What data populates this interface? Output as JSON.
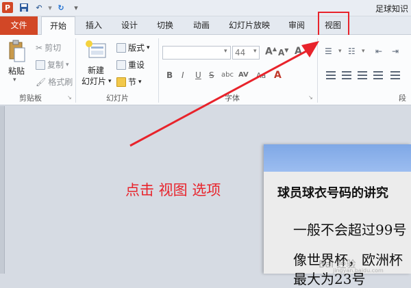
{
  "app": {
    "title": "足球知识",
    "logo_letter": "P"
  },
  "tabs": [
    "文件",
    "开始",
    "插入",
    "设计",
    "切换",
    "动画",
    "幻灯片放映",
    "审阅",
    "视图"
  ],
  "ribbon": {
    "clipboard": {
      "paste": "粘贴",
      "cut": "剪切",
      "copy": "复制",
      "format_painter": "格式刷",
      "label": "剪贴板"
    },
    "slides": {
      "new_slide_line1": "新建",
      "new_slide_line2": "幻灯片",
      "layout": "版式",
      "reset": "重设",
      "section": "节",
      "label": "幻灯片"
    },
    "font": {
      "size": "44",
      "bold": "B",
      "italic": "I",
      "underline": "U",
      "strike": "S",
      "shadow": "abc",
      "spacing": "AV",
      "case": "Aa",
      "grow": "A",
      "shrink": "A",
      "clear": "A",
      "label": "字体"
    },
    "paragraph": {
      "label": "段"
    }
  },
  "annotation": "点击  视图  选项",
  "slide": {
    "heading": "球员球衣号码的讲究",
    "line1": "一般不会超过99号",
    "line2": "像世界杯，欧洲杯",
    "line3": "最大为23号"
  },
  "watermark": {
    "text": "Bai 经验",
    "url": "jingyan.baidu.com"
  },
  "colors": {
    "accent_red": "#e8232b",
    "file_tab": "#d24726",
    "slide_header": "#8db2ea"
  }
}
